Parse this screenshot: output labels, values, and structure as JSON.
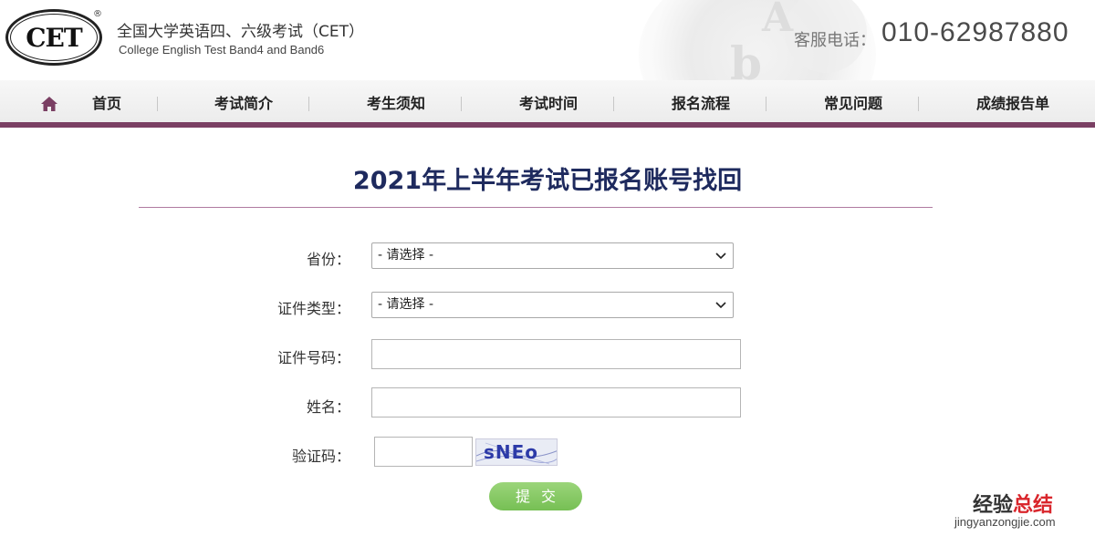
{
  "header": {
    "logo_text": "CET",
    "logo_reg": "®",
    "site_title_cn": "全国大学英语四、六级考试（CET）",
    "site_title_en": "College English Test Band4 and Band6",
    "hotline_label": "客服电话：",
    "hotline_number": "010-62987880"
  },
  "nav": {
    "home_icon": "home-icon",
    "items": [
      "首页",
      "考试简介",
      "考生须知",
      "考试时间",
      "报名流程",
      "常见问题",
      "成绩报告单"
    ]
  },
  "page": {
    "title": "2021年上半年考试已报名账号找回"
  },
  "form": {
    "province_label": "省份：",
    "province_value": "- 请选择 -",
    "id_type_label": "证件类型：",
    "id_type_value": "- 请选择 -",
    "id_number_label": "证件号码：",
    "name_label": "姓名：",
    "captcha_label": "验证码：",
    "captcha_image_text": "sNEo",
    "submit_label": "提交"
  },
  "watermark": {
    "cn_black": "经验",
    "cn_red": "总结",
    "url": "jingyanzongjie.com"
  },
  "colors": {
    "nav_border": "#7a3f63",
    "title": "#1e2a5e",
    "submit": "#82c85f",
    "watermark_red": "#d9262c"
  }
}
